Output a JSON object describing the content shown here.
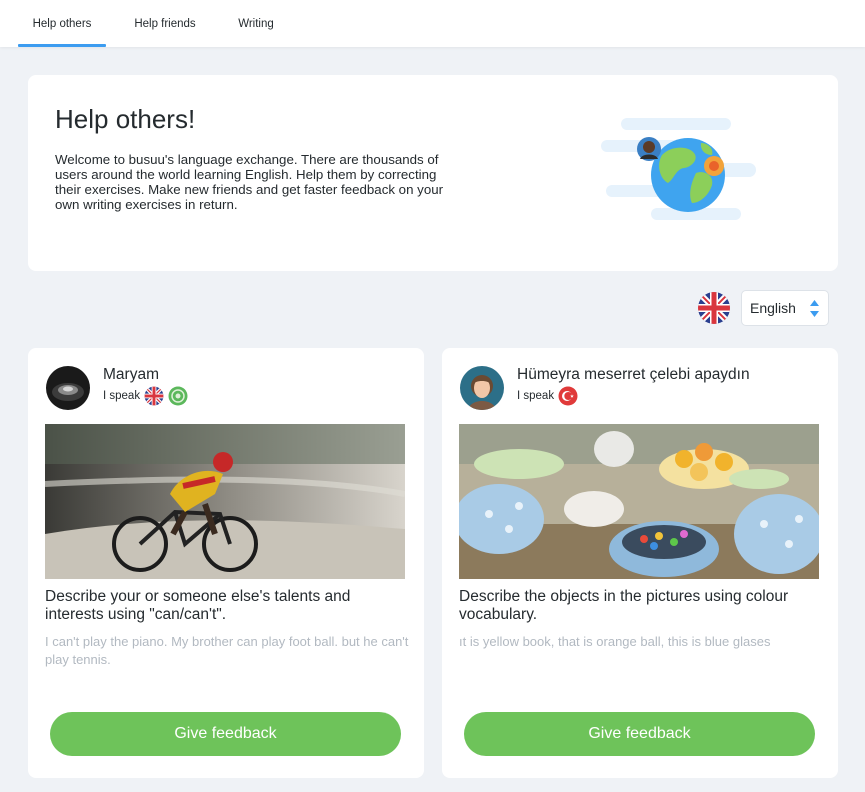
{
  "tabs": [
    {
      "label": "Help others",
      "active": true
    },
    {
      "label": "Help friends",
      "active": false
    },
    {
      "label": "Writing",
      "active": false
    }
  ],
  "hero": {
    "title": "Help others!",
    "text": "Welcome to busuu's language exchange. There are thousands of users around the world learning English. Help them by correcting their exercises. Make new friends and get faster feedback on your own writing exercises in return."
  },
  "language_selector": {
    "flag_icon": "uk-flag-icon",
    "selected": "English"
  },
  "cards": [
    {
      "username": "Maryam",
      "speaks_label": "I speak",
      "speaks_icons": [
        "uk-flag-icon",
        "arabic-flag-icon"
      ],
      "exercise_title": "Describe your or someone else's talents and interests using \"can/can't\".",
      "answer_preview": "I can't play the piano. My brother can play foot ball. but he can't play tennis.",
      "button_label": "Give feedback"
    },
    {
      "username": "Hümeyra meserret çelebi apaydın",
      "speaks_label": "I speak",
      "speaks_icons": [
        "turkey-flag-icon"
      ],
      "exercise_title": "Describe the objects in the pictures using colour vocabulary.",
      "answer_preview": "ıt is yellow book, that is orange ball, this is blue glases",
      "button_label": "Give feedback"
    }
  ],
  "colors": {
    "accent_tab": "#3c9cf0",
    "button_green": "#6ec35a",
    "page_bg": "#eff2f6",
    "muted_text": "#b2b9c1"
  }
}
